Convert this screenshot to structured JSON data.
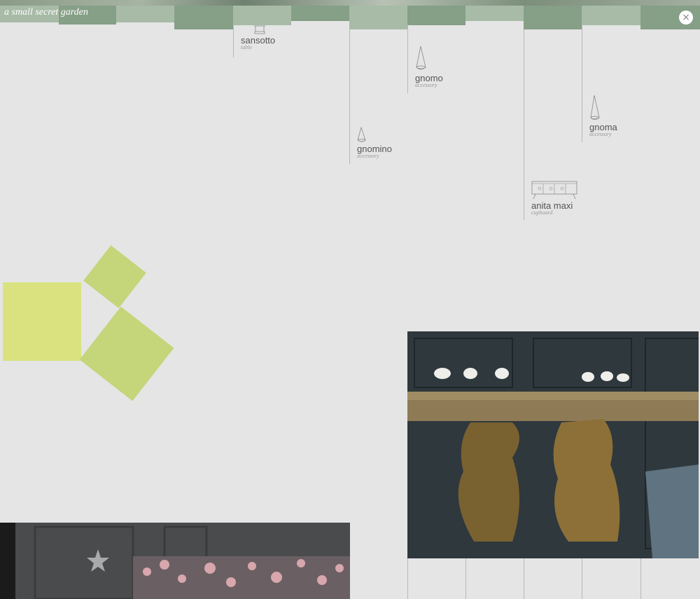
{
  "header": {
    "title": "a small secret garden",
    "close_symbol": "×"
  },
  "products": [
    {
      "name": "sansotto",
      "category": "table",
      "icon": "table-icon"
    },
    {
      "name": "gnomo",
      "category": "accessory",
      "icon": "gnome-hat-icon"
    },
    {
      "name": "gnomino",
      "category": "accessory",
      "icon": "gnome-hat-icon"
    },
    {
      "name": "gnoma",
      "category": "accessory",
      "icon": "gnome-hat-icon"
    },
    {
      "name": "anita maxi",
      "category": "cupboard",
      "icon": "cupboard-icon"
    }
  ],
  "colors": {
    "accent_green": "#869f87",
    "light_green": "#a7bba6",
    "square_yellow": "#d9e27f",
    "square_green": "#c4d57a"
  }
}
